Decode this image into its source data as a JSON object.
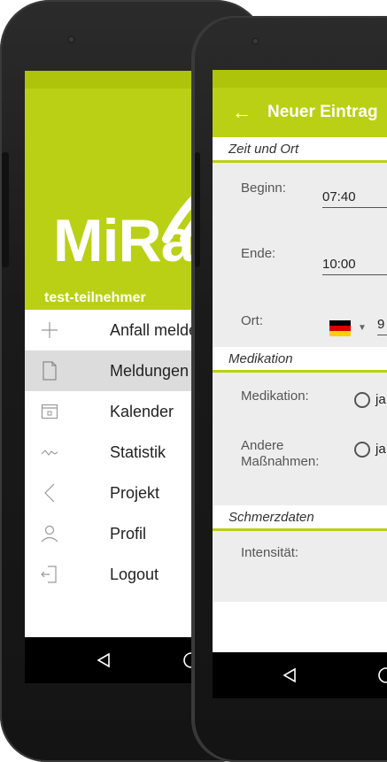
{
  "left_screen": {
    "logo": "MiRa",
    "username": "test-teilnehmer",
    "menu": [
      {
        "label": "Anfall melden",
        "icon": "plus-icon"
      },
      {
        "label": "Meldungen",
        "icon": "document-icon",
        "active": true
      },
      {
        "label": "Kalender",
        "icon": "calendar-icon"
      },
      {
        "label": "Statistik",
        "icon": "chart-icon"
      },
      {
        "label": "Projekt",
        "icon": "chevron-left-icon"
      },
      {
        "label": "Profil",
        "icon": "person-icon"
      },
      {
        "label": "Logout",
        "icon": "logout-icon"
      }
    ]
  },
  "right_screen": {
    "title": "Neuer Eintrag",
    "sections": {
      "zeit_ort": "Zeit und Ort",
      "medikation": "Medikation",
      "schmerzdaten": "Schmerzdaten"
    },
    "fields": {
      "beginn_label": "Beginn:",
      "beginn_value": "07:40",
      "ende_label": "Ende:",
      "ende_value": "10:00",
      "ort_label": "Ort:",
      "ort_value": "9",
      "medikation_label": "Medikation:",
      "radio_option": "ja",
      "andere_label_1": "Andere",
      "andere_label_2": "Maßnahmen:",
      "intensitaet_label": "Intensität:"
    }
  },
  "colors": {
    "accent": "#bad014",
    "accent_dark": "#aec40a"
  }
}
